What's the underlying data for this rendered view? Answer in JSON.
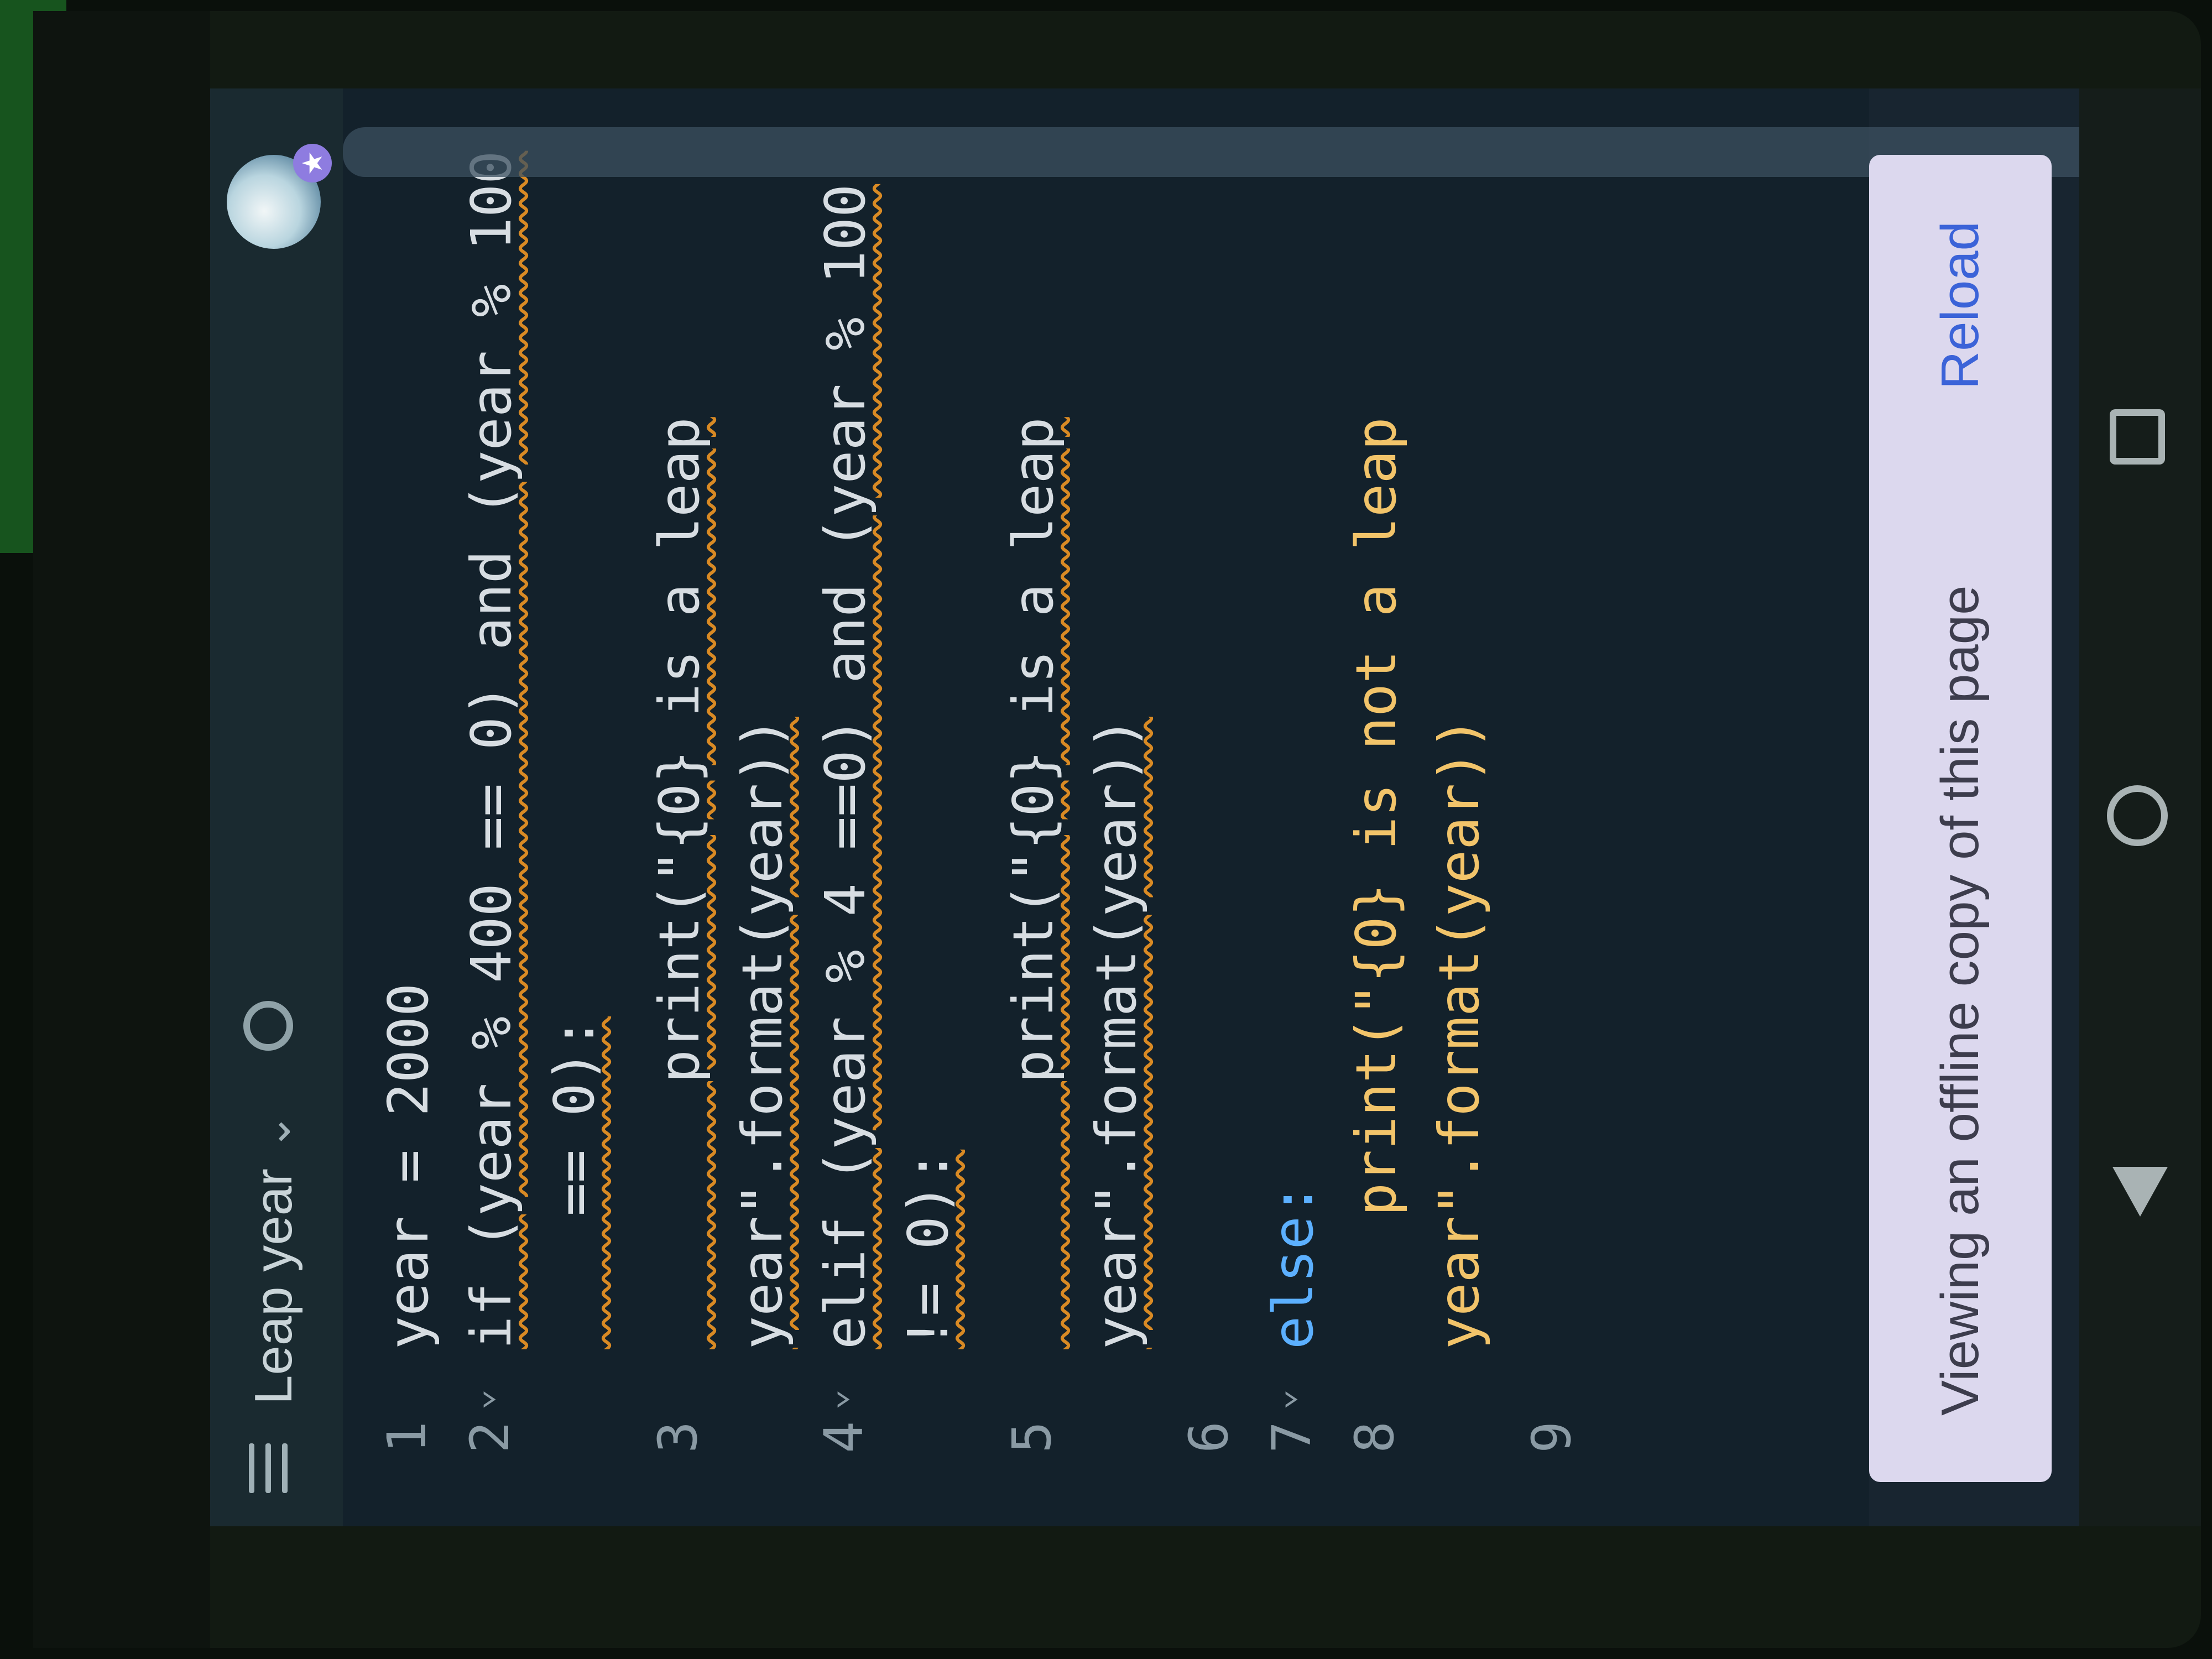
{
  "app": {
    "file_title": "Leap year"
  },
  "editor": {
    "lines": [
      {
        "no": "1",
        "text": "year = 2000"
      },
      {
        "no": "2",
        "text": "if (year % 400 == 0) and (year % 100"
      },
      {
        "no": "",
        "text": "    == 0):"
      },
      {
        "no": "3",
        "text": "        print(\"{0} is a leap"
      },
      {
        "no": "",
        "text": "year\".format(year))"
      },
      {
        "no": "4",
        "text": "elif (year % 4 ==0) and (year % 100"
      },
      {
        "no": "",
        "text": "!= 0):"
      },
      {
        "no": "5",
        "text": "        print(\"{0} is a leap"
      },
      {
        "no": "",
        "text": "year\".format(year))"
      },
      {
        "no": "6",
        "text": ""
      },
      {
        "no": "7",
        "text": "else:"
      },
      {
        "no": "8",
        "text": "    print(\"{0} is not a leap"
      },
      {
        "no": "",
        "text": "year\".format(year))"
      },
      {
        "no": "9",
        "text": ""
      }
    ]
  },
  "banner": {
    "message": "Viewing an offline copy of this page",
    "action": "Reload"
  },
  "icons": {
    "menu": "hamburger-menu-icon",
    "chevron": "chevron-down-icon",
    "sync": "sync-icon",
    "avatar": "user-avatar",
    "nav_back": "back-triangle-icon",
    "nav_home": "home-circle-icon",
    "nav_recent": "recent-apps-square-icon"
  },
  "colors": {
    "keyword": "#5cb0ff",
    "number": "#b9e36a",
    "string": "#f2c46a",
    "squiggle": "#d98a24",
    "reload": "#3b63d8"
  }
}
